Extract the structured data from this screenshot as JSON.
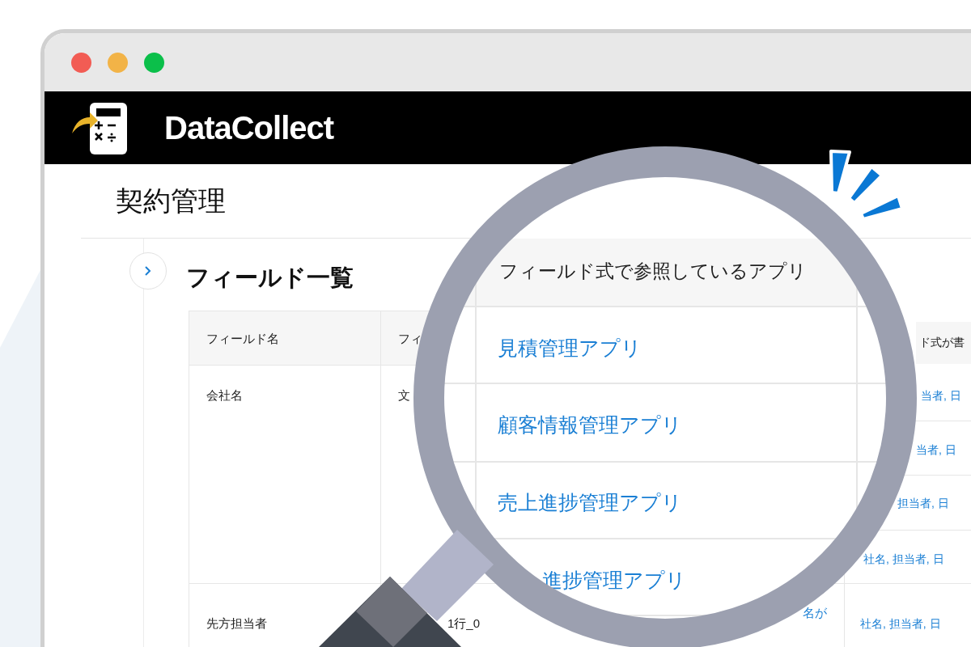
{
  "window": {
    "controls": [
      {
        "color": "#f25c54"
      },
      {
        "color": "#f2b347"
      },
      {
        "color": "#0bbf4a"
      }
    ]
  },
  "app": {
    "name": "DataCollect"
  },
  "page_title": "契約管理",
  "section": {
    "title": "フィールド一覧",
    "expanded": false
  },
  "table": {
    "columns": [
      "フィールド名",
      "フィ",
      "ド式が書"
    ],
    "rows": [
      {
        "name": "会社名",
        "type": "文",
        "refs": [
          "当者, 日",
          "当者, 日",
          "担当者, 日",
          "社名, 担当者, 日"
        ]
      },
      {
        "name": "先方担当者",
        "type": "1行_0",
        "column_3": "名が",
        "refs": [
          "社名, 担当者, 日"
        ]
      }
    ]
  },
  "magnifier": {
    "header": "フィールド式で参照しているアプリ",
    "links": [
      "見積管理アプリ",
      "顧客情報管理アプリ",
      "売上進捗管理アプリ",
      "進捗管理アプリ"
    ]
  }
}
